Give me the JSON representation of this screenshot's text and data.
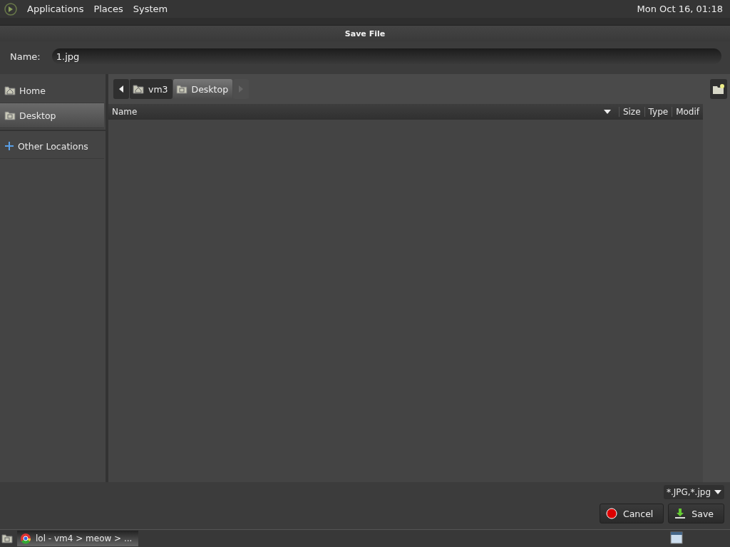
{
  "top_panel": {
    "menus": [
      "Applications",
      "Places",
      "System"
    ],
    "clock": "Mon Oct 16, 01:18"
  },
  "dialog": {
    "title": "Save File",
    "name_label": "Name:",
    "name_value": "1.jpg",
    "places": [
      {
        "label": "Home",
        "kind": "home",
        "selected": false
      },
      {
        "label": "Desktop",
        "kind": "desktop",
        "selected": true
      },
      {
        "label": "Other Locations",
        "kind": "other",
        "selected": false
      }
    ],
    "path": [
      {
        "label": "vm3",
        "kind": "home",
        "selected": false
      },
      {
        "label": "Desktop",
        "kind": "desktop",
        "selected": true
      }
    ],
    "columns": [
      "Name",
      "Size",
      "Type",
      "Modif"
    ],
    "filter": "*.JPG,*.jpg",
    "buttons": [
      {
        "label": "Cancel",
        "kind": "cancel"
      },
      {
        "label": "Save",
        "kind": "save"
      }
    ]
  },
  "taskbar": {
    "tasks": [
      {
        "label": "lol - vm4 > meow > ...",
        "selected": true
      }
    ]
  }
}
